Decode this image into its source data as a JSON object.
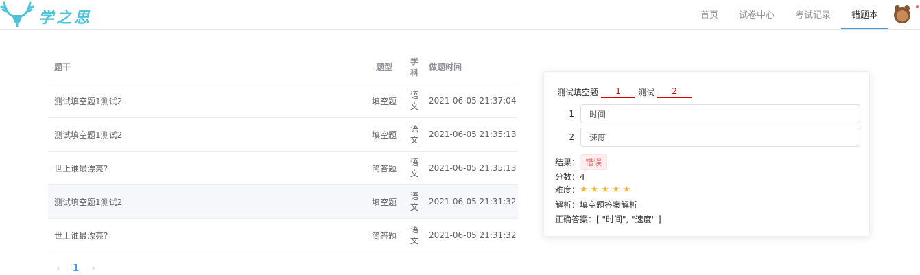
{
  "header": {
    "logo_text": "学之思",
    "nav": [
      {
        "label": "首页",
        "active": false
      },
      {
        "label": "试卷中心",
        "active": false
      },
      {
        "label": "考试记录",
        "active": false
      },
      {
        "label": "错题本",
        "active": true
      }
    ],
    "accent_color": "#409eff"
  },
  "table": {
    "columns": [
      "题干",
      "题型",
      "学科",
      "做题时间"
    ],
    "rows": [
      {
        "stem": "测试填空题1测试2",
        "type": "填空题",
        "subject": "语文",
        "time": "2021-06-05 21:37:04",
        "highlighted": false
      },
      {
        "stem": "测试填空题1测试2",
        "type": "填空题",
        "subject": "语文",
        "time": "2021-06-05 21:35:13",
        "highlighted": false
      },
      {
        "stem": "世上谁最漂亮?",
        "type": "简答题",
        "subject": "语文",
        "time": "2021-06-05 21:35:13",
        "highlighted": false
      },
      {
        "stem": "测试填空题1测试2",
        "type": "填空题",
        "subject": "语文",
        "time": "2021-06-05 21:31:32",
        "highlighted": true
      },
      {
        "stem": "世上谁最漂亮?",
        "type": "简答题",
        "subject": "语文",
        "time": "2021-06-05 21:31:32",
        "highlighted": false
      }
    ]
  },
  "pagination": {
    "prev": "‹",
    "current": "1",
    "next": "›"
  },
  "detail": {
    "question": {
      "part1": "测试填空题",
      "blank1": "1",
      "part2": "测试",
      "blank2": "2"
    },
    "answers": [
      {
        "index": "1",
        "value": "时间"
      },
      {
        "index": "2",
        "value": "速度"
      }
    ],
    "result_label": "结果：",
    "result_value": "错误",
    "score_label": "分数：",
    "score_value": "4",
    "difficulty_label": "难度：",
    "difficulty_stars": 5,
    "analysis_label": "解析：",
    "analysis_value": "填空题答案解析",
    "correct_label": "正确答案：",
    "correct_value": "[ \"时间\", \"速度\" ]"
  }
}
